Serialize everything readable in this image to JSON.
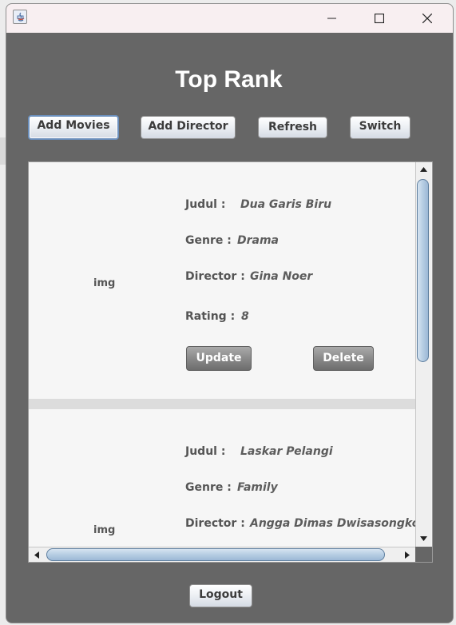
{
  "window": {
    "title": "",
    "controls": {
      "minimize": "minimize-icon",
      "maximize": "maximize-icon",
      "close": "close-icon"
    }
  },
  "header": {
    "title": "Top Rank"
  },
  "toolbar": {
    "add_movies": "Add Movies",
    "add_director": "Add Director",
    "refresh": "Refresh",
    "switch": "Switch"
  },
  "labels": {
    "img": "img",
    "judul": "Judul :",
    "genre": "Genre :",
    "director": "Director :",
    "rating": "Rating :",
    "update": "Update",
    "delete": "Delete"
  },
  "movies": [
    {
      "judul": "Dua Garis Biru",
      "genre": "Drama",
      "director": "Gina Noer",
      "rating": "8"
    },
    {
      "judul": "Laskar Pelangi",
      "genre": "Family",
      "director": "Angga Dimas Dwisasongko"
    }
  ],
  "footer": {
    "logout": "Logout"
  },
  "colors": {
    "background": "#666666",
    "card": "#f6f6f6",
    "title_text": "#ffffff",
    "button_dark": "#8a8a8a"
  }
}
